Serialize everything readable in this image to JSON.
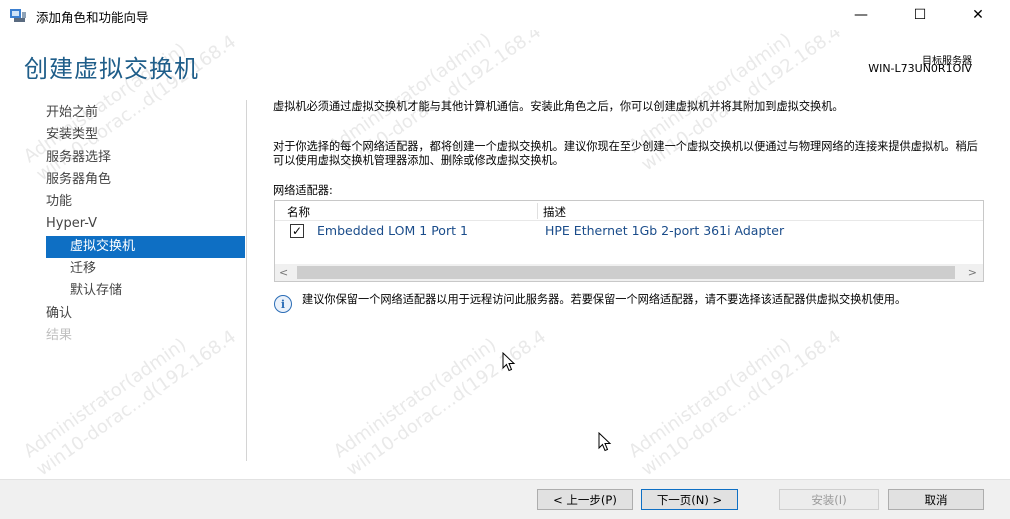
{
  "window": {
    "title": "添加角色和功能向导",
    "minimize_glyph": "—",
    "maximize_glyph": "☐",
    "close_glyph": "✕"
  },
  "header": {
    "page_title": "创建虚拟交换机",
    "target_server_label": "目标服务器",
    "target_server_name": "WIN-L73UN0R1OIV"
  },
  "nav": {
    "items": [
      {
        "label": "开始之前",
        "state": "normal",
        "level": 0
      },
      {
        "label": "安装类型",
        "state": "normal",
        "level": 0
      },
      {
        "label": "服务器选择",
        "state": "normal",
        "level": 0
      },
      {
        "label": "服务器角色",
        "state": "normal",
        "level": 0
      },
      {
        "label": "功能",
        "state": "normal",
        "level": 0
      },
      {
        "label": "Hyper-V",
        "state": "normal",
        "level": 0
      },
      {
        "label": "虚拟交换机",
        "state": "active",
        "level": 1
      },
      {
        "label": "迁移",
        "state": "normal",
        "level": 1
      },
      {
        "label": "默认存储",
        "state": "normal",
        "level": 1
      },
      {
        "label": "确认",
        "state": "normal",
        "level": 0
      },
      {
        "label": "结果",
        "state": "disabled",
        "level": 0
      }
    ]
  },
  "content": {
    "paragraph1": "虚拟机必须通过虚拟交换机才能与其他计算机通信。安装此角色之后，你可以创建虚拟机并将其附加到虚拟交换机。",
    "paragraph2": "对于你选择的每个网络适配器，都将创建一个虚拟交换机。建议你现在至少创建一个虚拟交换机以便通过与物理网络的连接来提供虚拟机。稍后可以使用虚拟交换机管理器添加、删除或修改虚拟交换机。",
    "adapters_label": "网络适配器:",
    "table": {
      "col_name": "名称",
      "col_desc": "描述",
      "rows": [
        {
          "checked": true,
          "name": "Embedded LOM 1 Port 1",
          "desc": "HPE Ethernet 1Gb 2-port 361i Adapter"
        }
      ],
      "scroll_left_glyph": "<",
      "scroll_right_glyph": ">"
    },
    "info_glyph": "i",
    "info_text": "建议你保留一个网络适配器以用于远程访问此服务器。若要保留一个网络适配器，请不要选择该适配器供虚拟交换机使用。"
  },
  "footer": {
    "prev_label": "< 上一步(P)",
    "next_label": "下一页(N) >",
    "install_label": "安装(I)",
    "cancel_label": "取消"
  },
  "watermark": {
    "line1": "Administrator(admin)",
    "line2": "win10-dorac...d(192.168.4"
  },
  "colors": {
    "accent": "#0e6fc4",
    "title_blue": "#1f5e8a",
    "link_blue": "#1a4c8a"
  }
}
